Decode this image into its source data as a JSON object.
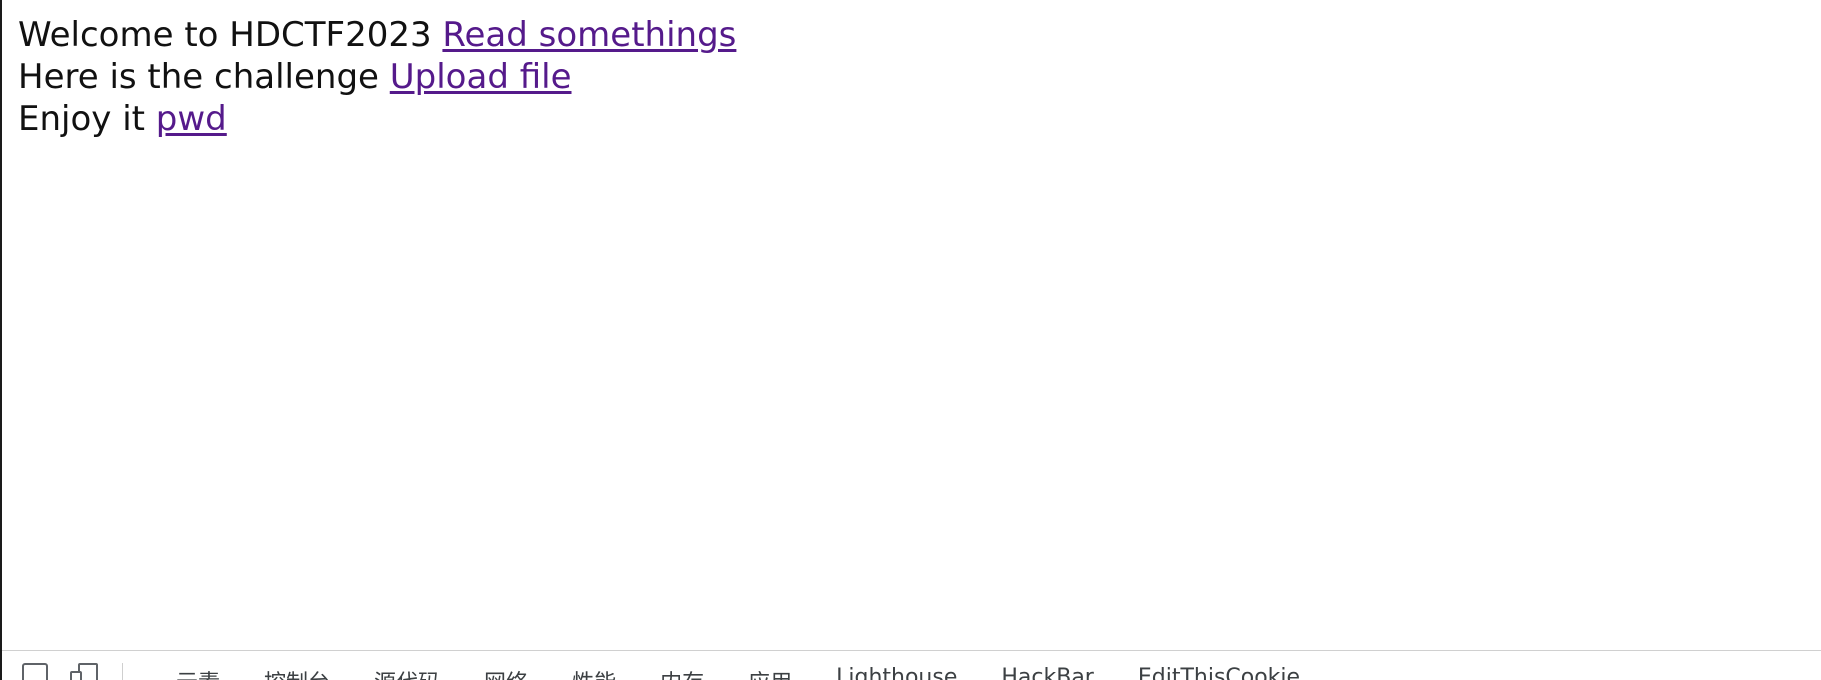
{
  "page": {
    "lines": [
      {
        "prefix": "Welcome to HDCTF2023 ",
        "link_text": "Read somethings"
      },
      {
        "prefix": "Here is the challenge ",
        "link_text": "Upload file"
      },
      {
        "prefix": "Enjoy it ",
        "link_text": "pwd"
      }
    ]
  },
  "devtools": {
    "tabs": [
      "元素",
      "控制台",
      "源代码",
      "网络",
      "性能",
      "内存",
      "应用",
      "Lighthouse",
      "HackBar",
      "EditThisCookie"
    ],
    "icons": [
      "inspect-element-icon",
      "device-toolbar-icon"
    ]
  },
  "colors": {
    "link": "#551a8b",
    "text": "#111111",
    "background": "#ffffff"
  }
}
